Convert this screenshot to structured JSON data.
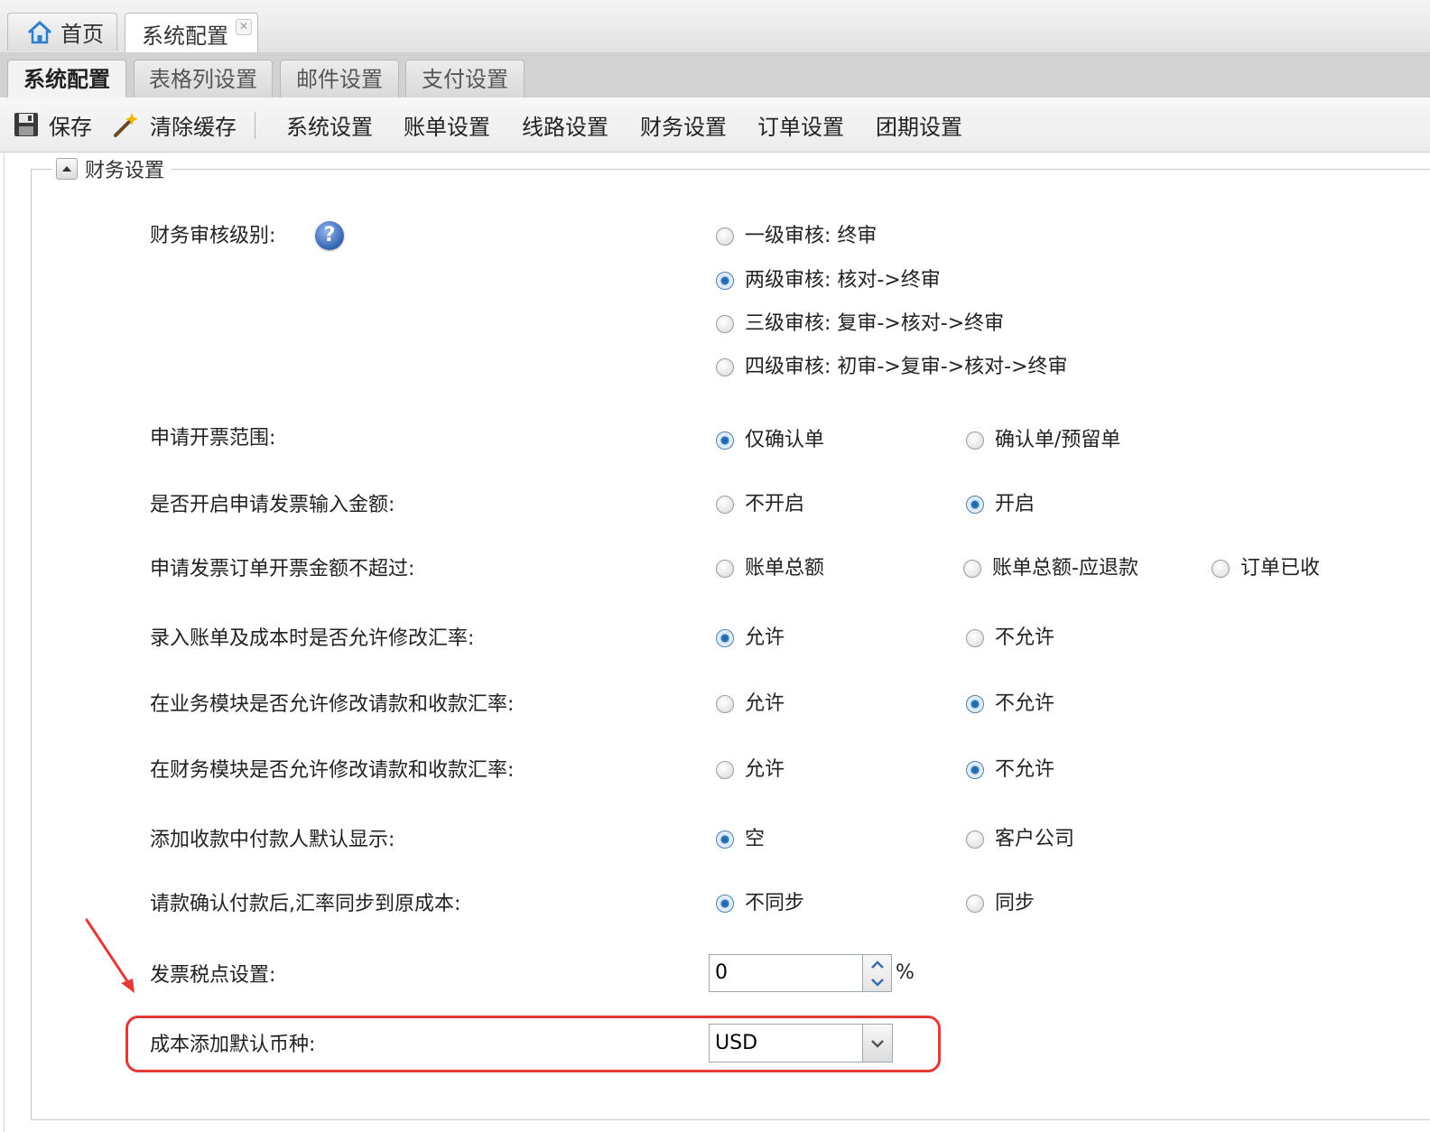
{
  "top_tabs": [
    {
      "label": "首页",
      "icon": "home-icon"
    },
    {
      "label": "系统配置",
      "closable": true,
      "active": true
    }
  ],
  "sub_tabs": [
    {
      "label": "系统配置",
      "active": true
    },
    {
      "label": "表格列设置"
    },
    {
      "label": "邮件设置"
    },
    {
      "label": "支付设置"
    }
  ],
  "toolbar": {
    "save_label": "保存",
    "clear_cache_label": "清除缓存",
    "sections": [
      "系统设置",
      "账单设置",
      "线路设置",
      "财务设置",
      "订单设置",
      "团期设置"
    ]
  },
  "fieldset": {
    "legend": "财务设置",
    "rows": [
      {
        "label": "财务审核级别:",
        "options": [
          "一级审核: 终审",
          "两级审核: 核对->终审",
          "三级审核: 复审->核对->终审",
          "四级审核: 初审->复审->核对->终审"
        ],
        "selected": 1
      },
      {
        "label": "申请开票范围:",
        "options": [
          "仅确认单",
          "确认单/预留单"
        ],
        "selected": 0
      },
      {
        "label": "是否开启申请发票输入金额:",
        "options": [
          "不开启",
          "开启"
        ],
        "selected": 1
      },
      {
        "label": "申请发票订单开票金额不超过:",
        "options": [
          "账单总额",
          "账单总额-应退款",
          "订单已收"
        ],
        "selected": -1
      },
      {
        "label": "录入账单及成本时是否允许修改汇率:",
        "options": [
          "允许",
          "不允许"
        ],
        "selected": 0
      },
      {
        "label": "在业务模块是否允许修改请款和收款汇率:",
        "options": [
          "允许",
          "不允许"
        ],
        "selected": 1
      },
      {
        "label": "在财务模块是否允许修改请款和收款汇率:",
        "options": [
          "允许",
          "不允许"
        ],
        "selected": 1
      },
      {
        "label": "添加收款中付款人默认显示:",
        "options": [
          "空",
          "客户公司"
        ],
        "selected": 0
      },
      {
        "label": "请款确认付款后,汇率同步到原成本:",
        "options": [
          "不同步",
          "同步"
        ],
        "selected": 0
      }
    ],
    "tax_point": {
      "label": "发票税点设置:",
      "value": "0",
      "unit": "%"
    },
    "default_currency": {
      "label": "成本添加默认币种:",
      "value": "USD"
    }
  },
  "colors": {
    "annotation_red": "#e53935",
    "radio_selected": "#2f78bd"
  }
}
